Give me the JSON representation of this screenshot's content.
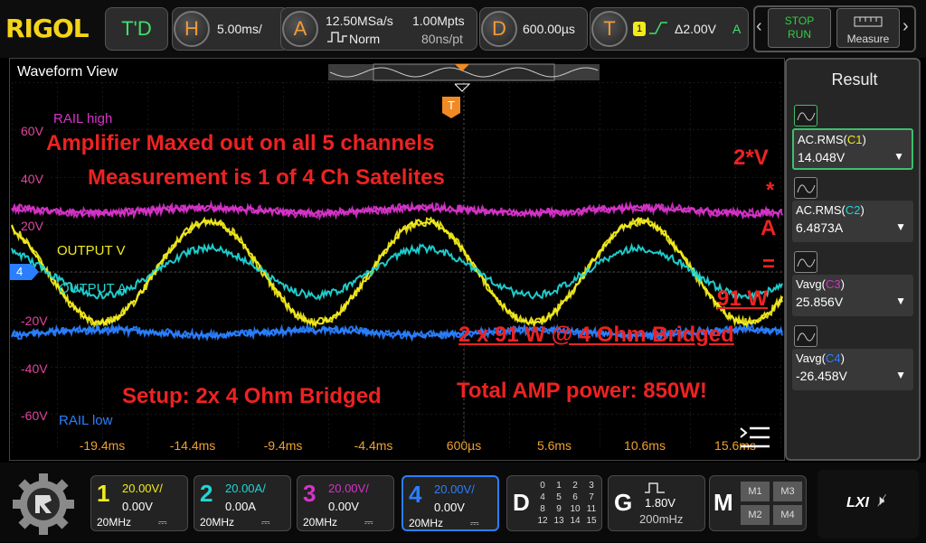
{
  "top_bar": {
    "logo": "RIGOL",
    "td_label": "T'D",
    "horizontal": {
      "badge": "H",
      "timebase": "5.00ms/"
    },
    "acquire": {
      "badge": "A",
      "sample_rate": "12.50MSa/s",
      "mode": "Norm",
      "mem_depth": "1.00Mpts",
      "sample_interval": "80ns/pt"
    },
    "delay": {
      "badge": "D",
      "value": "600.00µs"
    },
    "trigger": {
      "badge": "T",
      "source": "1",
      "level": "Δ2.00V",
      "mode": "A"
    },
    "run_button": {
      "line1": "STOP",
      "line2": "RUN"
    },
    "measure_button": {
      "label": "Measure"
    },
    "nav_left": "‹",
    "nav_right": "›"
  },
  "waveform": {
    "title": "Waveform View",
    "y_labels": [
      "60V",
      "40V",
      "20V",
      "-20V",
      "-40V",
      "-60V"
    ],
    "x_labels": [
      "-19.4ms",
      "-14.4ms",
      "-9.4ms",
      "-4.4ms",
      "600µs",
      "5.6ms",
      "10.6ms",
      "15.6ms"
    ],
    "channel_marker": "4",
    "trigger_marker": "T",
    "signal_labels": {
      "rail_high": "RAIL high",
      "output_v": "OUTPUT V",
      "output_a": "OUTPUT A",
      "rail_low": "RAIL low"
    },
    "annotations": {
      "line1": "Amplifier Maxed out on all 5 channels",
      "line2": "Measurement is 1 of 4 Ch Satelites",
      "formula1": "2*V",
      "formula2": "*",
      "formula3": "A",
      "formula4": "=",
      "result": "91 W",
      "bridged": "2 x 91 W @ 4 Ohm Bridged",
      "setup": "Setup: 2x 4 Ohm  Bridged",
      "total": "Total AMP power: 850W!"
    },
    "colors": {
      "ch1": "#f2ea1c",
      "ch2": "#20d6d6",
      "ch3": "#d633c9",
      "ch4": "#2a7fff",
      "annotation": "#ee2222",
      "axis": "#f0a030"
    }
  },
  "result_panel": {
    "title": "Result",
    "items": [
      {
        "label_prefix": "AC.RMS(",
        "channel": "C1",
        "label_suffix": ")",
        "value": "14.048V",
        "color": "#f2ea1c"
      },
      {
        "label_prefix": "AC.RMS(",
        "channel": "C2",
        "label_suffix": ")",
        "value": "6.4873A",
        "color": "#20d6d6"
      },
      {
        "label_prefix": "Vavg(",
        "channel": "C3",
        "label_suffix": ")",
        "value": "25.856V",
        "color": "#d633c9"
      },
      {
        "label_prefix": "Vavg(",
        "channel": "C4",
        "label_suffix": ")",
        "value": "-26.458V",
        "color": "#2a7fff"
      }
    ]
  },
  "bottom_bar": {
    "channels": [
      {
        "num": "1",
        "scale": "20.00V/",
        "offset": "0.00V",
        "bw": "20MHz",
        "color": "#f2ea1c"
      },
      {
        "num": "2",
        "scale": "20.00A/",
        "offset": "0.00A",
        "bw": "20MHz",
        "color": "#20d6d6"
      },
      {
        "num": "3",
        "scale": "20.00V/",
        "offset": "0.00V",
        "bw": "20MHz",
        "color": "#d633c9"
      },
      {
        "num": "4",
        "scale": "20.00V/",
        "offset": "0.00V",
        "bw": "20MHz",
        "color": "#2a7fff"
      }
    ],
    "digital": {
      "label": "D",
      "rows": [
        [
          "0",
          "1",
          "2",
          "3"
        ],
        [
          "4",
          "5",
          "6",
          "7"
        ],
        [
          "8",
          "9",
          "10",
          "11"
        ],
        [
          "12",
          "13",
          "14",
          "15"
        ]
      ]
    },
    "generator": {
      "label": "G",
      "amplitude": "1.80V",
      "frequency": "200mHz"
    },
    "math": {
      "label": "M",
      "cells": [
        "M1",
        "M3",
        "M2",
        "M4"
      ]
    },
    "lxi_label": "LXI"
  }
}
